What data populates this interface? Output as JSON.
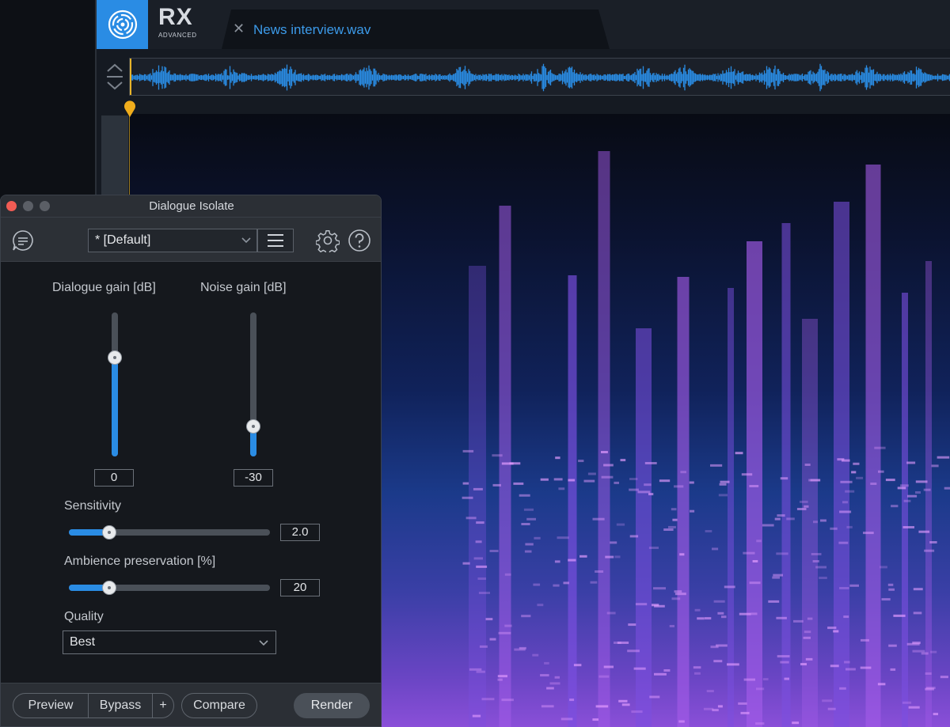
{
  "app": {
    "brand_name": "RX",
    "brand_edition": "ADVANCED",
    "accent_color": "#2a8ce4",
    "playhead_color": "#e8b42a"
  },
  "file_tab": {
    "close_icon": "close-icon",
    "title": "News interview.wav"
  },
  "plugin_window": {
    "title": "Dialogue Isolate",
    "preset": {
      "value": "* [Default]"
    },
    "header_icons": [
      "chat-icon",
      "menu-icon",
      "gear-icon",
      "help-icon"
    ],
    "dialogue_gain": {
      "label": "Dialogue gain [dB]",
      "value": "0",
      "fill_fraction": 0.7
    },
    "noise_gain": {
      "label": "Noise gain [dB]",
      "value": "-30",
      "fill_fraction": 0.2
    },
    "sensitivity": {
      "label": "Sensitivity",
      "value": "2.0",
      "fill_fraction": 0.2
    },
    "ambience_preservation": {
      "label": "Ambience preservation [%]",
      "value": "20",
      "fill_fraction": 0.2
    },
    "quality": {
      "label": "Quality",
      "value": "Best"
    },
    "footer": {
      "preview": "Preview",
      "bypass": "Bypass",
      "plus": "+",
      "compare": "Compare",
      "render": "Render"
    }
  }
}
